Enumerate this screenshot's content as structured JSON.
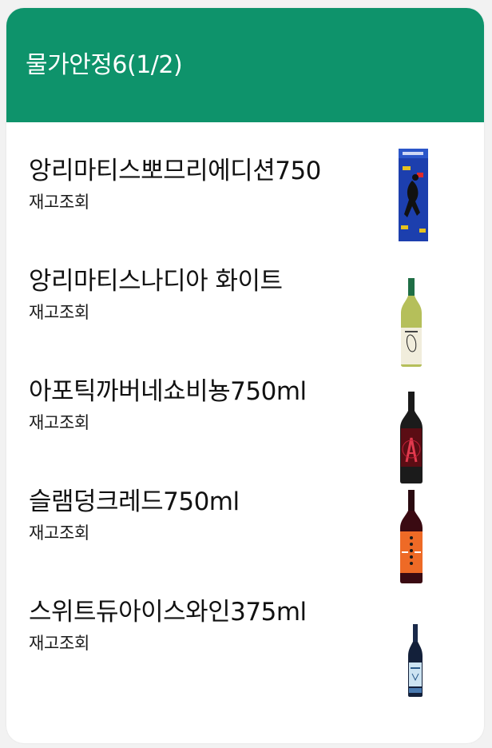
{
  "header": {
    "title": "물가안정6(1/2)"
  },
  "products": [
    {
      "name": "앙리마티스뽀므리에디션750",
      "action": "재고조회",
      "image": "gift-box-blue-image"
    },
    {
      "name": "앙리마티스나디아 화이트",
      "action": "재고조회",
      "image": "white-wine-bottle-image"
    },
    {
      "name": "아포틱까버네쇼비뇽750ml",
      "action": "재고조회",
      "image": "red-wine-bottle-image"
    },
    {
      "name": "슬램덩크레드750ml",
      "action": "재고조회",
      "image": "red-wine-orange-label-image"
    },
    {
      "name": "스위트듀아이스와인375ml",
      "action": "재고조회",
      "image": "ice-wine-bottle-image"
    }
  ],
  "colors": {
    "header": "#0e936b",
    "background": "#ffffff"
  }
}
